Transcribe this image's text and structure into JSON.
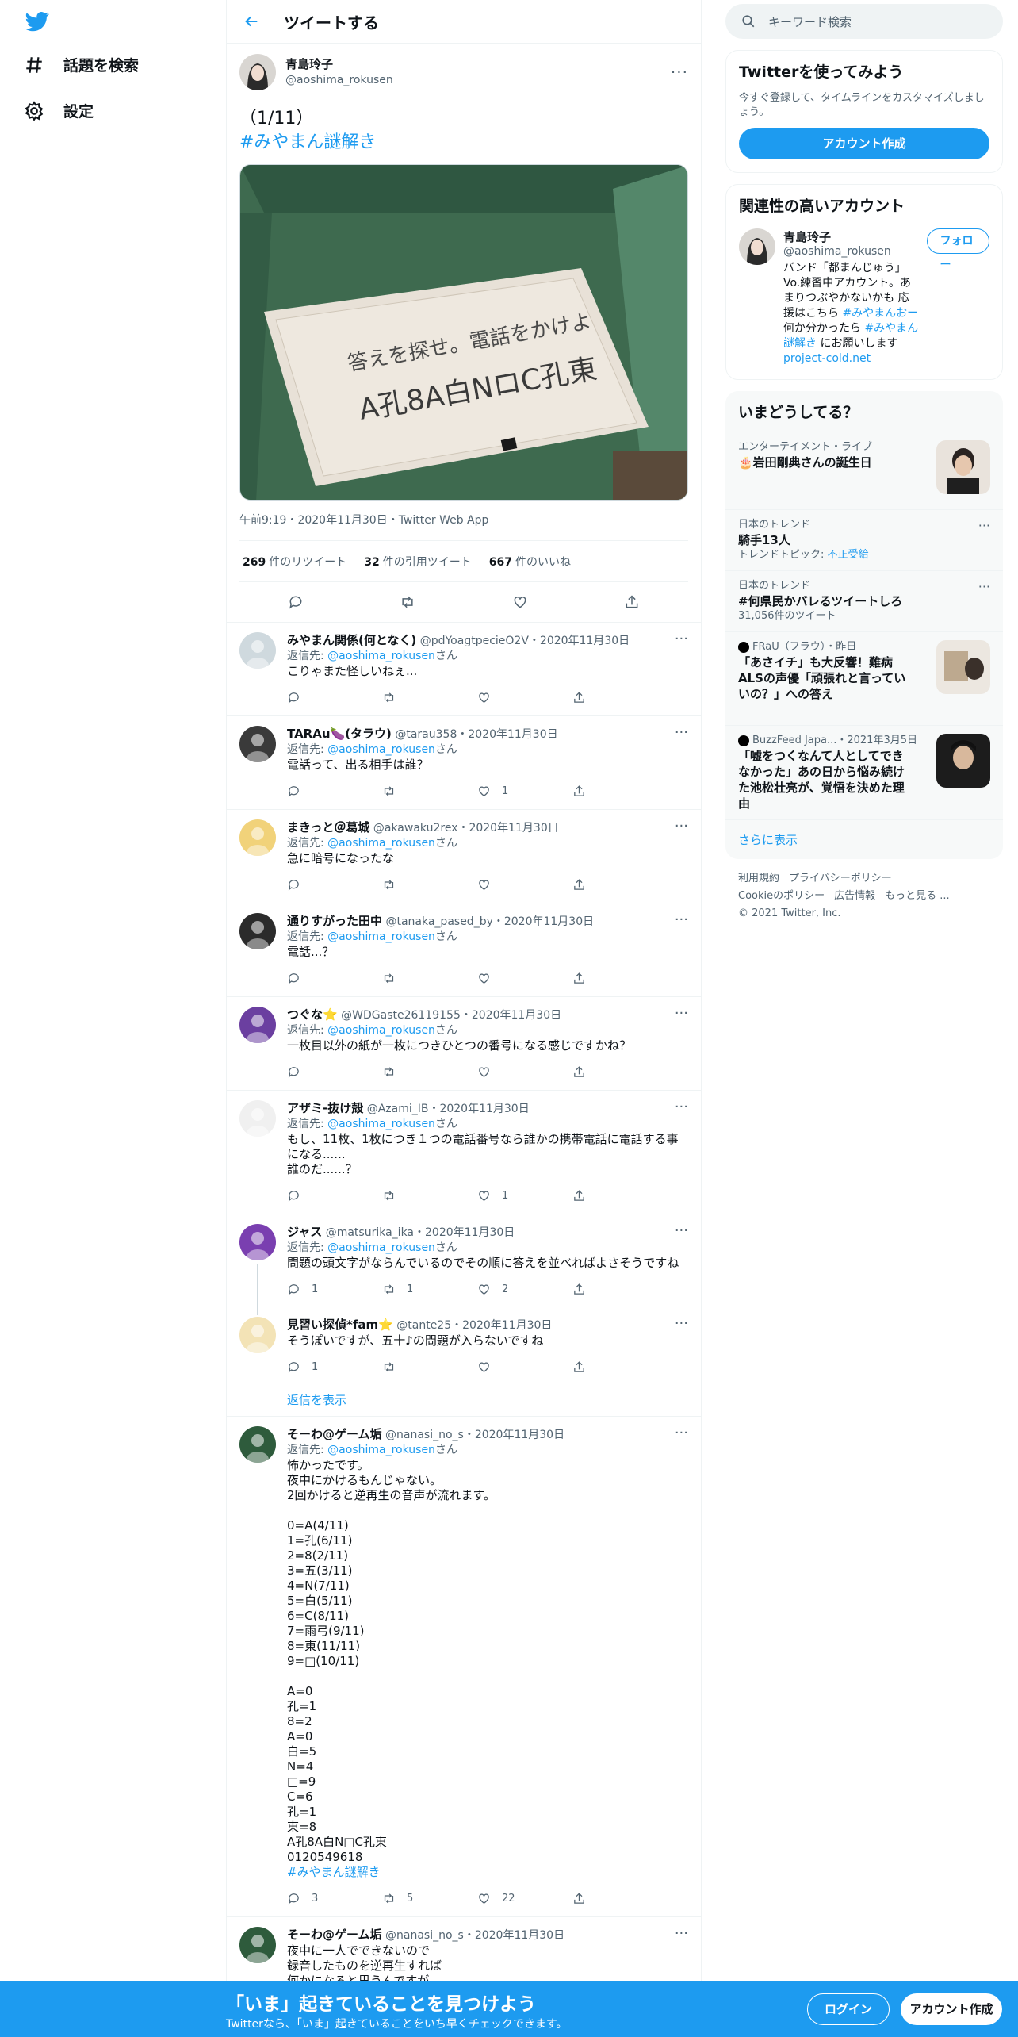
{
  "nav": {
    "explore_label": "話題を検索",
    "settings_label": "設定"
  },
  "header": {
    "title": "ツイートする"
  },
  "main_tweet": {
    "display_name": "青島玲子",
    "handle": "@aoshima_rokusen",
    "text_line1": "（1/11）",
    "hashtag": "#みやまん謎解き",
    "photo_text_line1": "答えを探せ。電話をかけよ",
    "photo_text_line2": "A孔8A白NロC孔東",
    "meta": "午前9:19・2020年11月30日・Twitter Web App",
    "retweets_count": "269",
    "retweets_label": "件のリツイート",
    "quotes_count": "32",
    "quotes_label": "件の引用ツイート",
    "likes_count": "667",
    "likes_label": "件のいいね"
  },
  "replies": [
    {
      "name": "みやまん関係(何となく)",
      "handle_date": "@pdYoagtpecieO2V・2020年11月30日",
      "to_prefix": "返信先: ",
      "to_handle": "@aoshima_rokusen",
      "to_suffix": "さん",
      "text": "こりゃまた怪しいねぇ...",
      "reply_count": "",
      "rt_count": "",
      "like_count": ""
    },
    {
      "name": "TARAu🍆(タラウ)",
      "handle_date": "@tarau358・2020年11月30日",
      "to_prefix": "返信先: ",
      "to_handle": "@aoshima_rokusen",
      "to_suffix": "さん",
      "text": "電話って、出る相手は誰？",
      "reply_count": "",
      "rt_count": "",
      "like_count": "1"
    },
    {
      "name": "まきっと＠葛城",
      "handle_date": "@akawaku2rex・2020年11月30日",
      "to_prefix": "返信先: ",
      "to_handle": "@aoshima_rokusen",
      "to_suffix": "さん",
      "text": "急に暗号になったな",
      "reply_count": "",
      "rt_count": "",
      "like_count": ""
    },
    {
      "name": "通りすがった田中",
      "handle_date": "@tanaka_pased_by・2020年11月30日",
      "to_prefix": "返信先: ",
      "to_handle": "@aoshima_rokusen",
      "to_suffix": "さん",
      "text": "電話...？",
      "reply_count": "",
      "rt_count": "",
      "like_count": ""
    },
    {
      "name": "つぐな⭐",
      "handle_date": "@WDGaste26119155・2020年11月30日",
      "to_prefix": "返信先: ",
      "to_handle": "@aoshima_rokusen",
      "to_suffix": "さん",
      "text": "一枚目以外の紙が一枚につきひとつの番号になる感じですかね？",
      "reply_count": "",
      "rt_count": "",
      "like_count": ""
    },
    {
      "name": "アザミ-抜け殻",
      "handle_date": "@Azami_IB・2020年11月30日",
      "to_prefix": "返信先: ",
      "to_handle": "@aoshima_rokusen",
      "to_suffix": "さん",
      "text": "もし、11枚、1枚につき１つの電話番号なら誰かの携帯電話に電話する事になる......\n誰のだ......？",
      "reply_count": "",
      "rt_count": "",
      "like_count": "1"
    },
    {
      "name": "ジャス",
      "handle_date": "@matsurika_ika・2020年11月30日",
      "to_prefix": "返信先: ",
      "to_handle": "@aoshima_rokusen",
      "to_suffix": "さん",
      "text": "問題の頭文字がならんでいるのでその順に答えを並べればよさそうですね",
      "reply_count": "1",
      "rt_count": "1",
      "like_count": "2"
    },
    {
      "name": "見習い探偵*fam⭐",
      "handle_date": "@tante25・2020年11月30日",
      "to_prefix": "",
      "to_handle": "",
      "to_suffix": "",
      "text": "そうぽいですが、五十♪の問題が入らないですね",
      "reply_count": "1",
      "rt_count": "",
      "like_count": ""
    },
    {
      "name": "そーわ@ゲーム垢",
      "handle_date": "@nanasi_no_s・2020年11月30日",
      "to_prefix": "返信先: ",
      "to_handle": "@aoshima_rokusen",
      "to_suffix": "さん",
      "text": "怖かったです。\n夜中にかけるもんじゃない。\n2回かけると逆再生の音声が流れます。\n\n0=A(4/11)\n1=孔(6/11)\n2=8(2/11)\n3=五(3/11)\n4=N(7/11)\n5=白(5/11)\n6=C(8/11)\n7=雨弓(9/11)\n8=東(11/11)\n9=□(10/11)\n\nA=0\n孔=1\n8=2\nA=0\n白=5\nN=4\n□=9\nC=6\n孔=1\n東=8\nA孔8A白N□C孔東\n0120549618",
      "hashtag": "#みやまん謎解き",
      "reply_count": "3",
      "rt_count": "5",
      "like_count": "22"
    },
    {
      "name": "そーわ@ゲーム垢",
      "handle_date": "@nanasi_no_s・2020年11月30日",
      "to_prefix": "",
      "to_handle": "",
      "to_suffix": "",
      "text": "夜中に一人でできないので\n録音したものを逆再生すれば\n何かになると思うんですが、、",
      "reply_count": "",
      "rt_count": "",
      "like_count": ""
    }
  ],
  "show_replies_label": "返信を表示",
  "search": {
    "placeholder": "キーワード検索"
  },
  "signup_card": {
    "title": "Twitterを使ってみよう",
    "desc": "今すぐ登録して、タイムラインをカスタマイズしましょう。",
    "button": "アカウント作成"
  },
  "relevant": {
    "title": "関連性の高いアカウント",
    "name": "青島玲子",
    "handle": "@aoshima_rokusen",
    "follow": "フォロー",
    "bio_1": "バンド「都まんじゅう」Vo.練習中アカウント。あまりつぶやかないかも 応援はこちら ",
    "bio_tag1": "#みやまんおー",
    "bio_2": " 何か分かったら ",
    "bio_tag2": "#みやまん謎解き",
    "bio_3": " にお願いします ",
    "bio_link": "project-cold.net"
  },
  "trends": {
    "title": "いまどうしてる？",
    "items": [
      {
        "category": "エンターテイメント・ライブ",
        "title": "🎂岩田剛典さんの誕生日",
        "sub": ""
      },
      {
        "category": "日本のトレンド",
        "title": "騎手13人",
        "sub_prefix": "トレンドトピック: ",
        "sub_link": "不正受給"
      },
      {
        "category": "日本のトレンド",
        "title": "#何県民かバレるツイートしろ",
        "sub": "31,056件のツイート"
      },
      {
        "category": "FRaU（フラウ）・昨日",
        "title": "「あさイチ」も大反響！難病ALSの声優「頑張れと言っていいの？」への答え"
      },
      {
        "category": "BuzzFeed Japa...・2021年3月5日",
        "title": "「嘘をつくなんて人としてできなかった」あの日から悩み続けた池松壮亮が、覚悟を決めた理由"
      }
    ],
    "show_more": "さらに表示"
  },
  "footer": {
    "l1": "利用規約",
    "l2": "プライバシーポリシー",
    "l3": "Cookieのポリシー",
    "l4": "広告情報",
    "l5": "もっと見る ...",
    "copy": "© 2021 Twitter, Inc."
  },
  "bottom_bar": {
    "title": "「いま」起きていることを見つけよう",
    "sub": "Twitterなら、「いま」起きていることをいち早くチェックできます。",
    "login": "ログイン",
    "signup": "アカウント作成"
  },
  "colors": {
    "accent": "#1d9bf0",
    "text": "#0f1419",
    "muted": "#536471"
  }
}
